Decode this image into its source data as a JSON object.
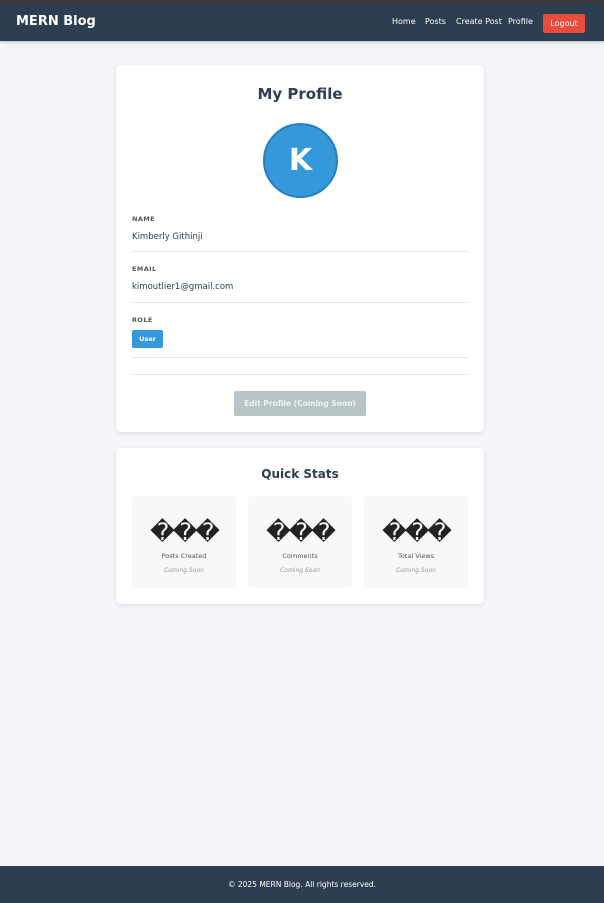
{
  "navbar": {
    "brand": "MERN Blog",
    "links": [
      "Home",
      "Posts",
      "Create Post",
      "Profile"
    ],
    "logout_label": "Logout"
  },
  "profile": {
    "title": "My Profile",
    "avatar_initial": "K",
    "name_label": "NAME",
    "name_value": "Kimberly Githinji",
    "email_label": "EMAIL",
    "email_value": "kimoutlier1@gmail.com",
    "role_label": "ROLE",
    "role_value": "User",
    "edit_button": "Edit Profile (Coming Soon)"
  },
  "stats": {
    "title": "Quick Stats",
    "items": [
      {
        "icon": "���",
        "label": "Posts Created",
        "sub": "Coming Soon"
      },
      {
        "icon": "���",
        "label": "Comments",
        "sub": "Coming Soon"
      },
      {
        "icon": "���",
        "label": "Total Views",
        "sub": "Coming Soon"
      }
    ]
  },
  "footer": {
    "text": "© 2025 MERN Blog. All rights reserved."
  },
  "colors": {
    "navbar": "#2c3e50",
    "logout": "#e74c3c",
    "accent": "#3498db",
    "disabled_button": "#b7c4c5",
    "page_bg": "#f3f5f9"
  }
}
